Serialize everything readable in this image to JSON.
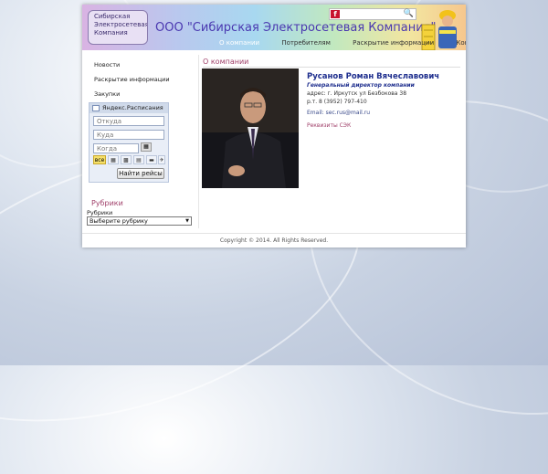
{
  "header": {
    "logo_lines": [
      "Сибирская",
      "Электросетевая",
      "Компания"
    ],
    "title": "ООО \"Сибирская Электросетевая Компания\"",
    "nav": [
      {
        "label": "О компании",
        "active": true
      },
      {
        "label": "Потребителям",
        "active": false
      },
      {
        "label": "Раскрытие информации",
        "active": false
      },
      {
        "label": "Контакты",
        "active": false
      }
    ]
  },
  "sidebar": {
    "links": [
      "Новости",
      "Раскрытие информации",
      "Закупки"
    ],
    "schedule_widget": {
      "title": "Яндекс.Расписания",
      "from_placeholder": "Откуда",
      "to_placeholder": "Куда",
      "date_placeholder": "Когда",
      "transport_all": "все",
      "submit_label": "Найти рейсы"
    },
    "rubrics": {
      "heading": "Рубрики",
      "label": "Рубрики",
      "selected": "Выберите рубрику"
    }
  },
  "main": {
    "heading": "О компании",
    "person": {
      "name": "Русанов Роман Вячеславович",
      "role": "Генеральный директор компании",
      "address": "адрес: г. Иркутск ул Безбокова 38",
      "phone": "р.т. 8 (3952) 797-410",
      "email": "Email: sec.rus@mail.ru",
      "link": "Реквизиты СЭК"
    }
  },
  "footer": {
    "copyright": "Copyright © 2014. All Rights Reserved."
  },
  "colors": {
    "accent": "#a0406a",
    "title_blue": "#4a38b0",
    "name_blue": "#1f2f8e"
  }
}
